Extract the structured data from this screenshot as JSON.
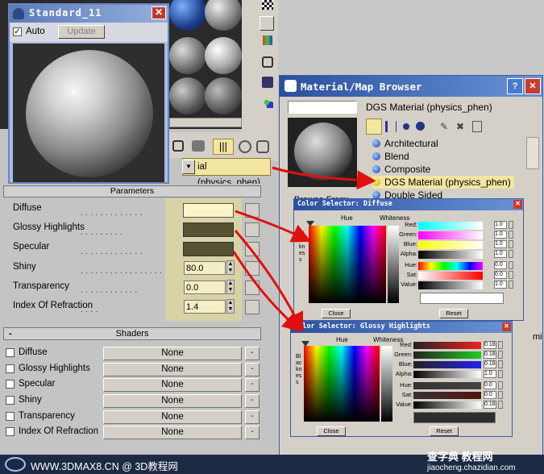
{
  "viewport": {
    "width": 675,
    "height": 588
  },
  "material_preview": {
    "title": "Standard_11",
    "auto_label": "Auto",
    "auto_checked": true,
    "update_label": "Update"
  },
  "editor": {
    "material_name_field": "ial (physics_phen)",
    "rollout_title": "Parameters",
    "params": [
      {
        "label": "Diffuse",
        "type": "color",
        "color": "#fbf4c8"
      },
      {
        "label": "Glossy Highlights",
        "type": "color",
        "color": "#575234"
      },
      {
        "label": "Specular",
        "type": "color",
        "color": "#575234"
      },
      {
        "label": "Shiny",
        "type": "number",
        "value": "80.0"
      },
      {
        "label": "Transparency",
        "type": "number",
        "value": "0.0"
      },
      {
        "label": "Index Of Refraction",
        "type": "number",
        "value": "1.4"
      }
    ],
    "shaders_title": "Shaders",
    "shaders": [
      {
        "label": "Diffuse",
        "value": "None"
      },
      {
        "label": "Glossy Highlights",
        "value": "None"
      },
      {
        "label": "Specular",
        "value": "None"
      },
      {
        "label": "Shiny",
        "value": "None"
      },
      {
        "label": "Transparency",
        "value": "None"
      },
      {
        "label": "Index Of Refraction",
        "value": "None"
      }
    ],
    "rollout_minus": "-",
    "shader_button_label": "-"
  },
  "browser": {
    "title": "Material/Map Browser",
    "name_field": "DGS Material (physics_phen)",
    "browse_from": "Browse From:",
    "items": [
      {
        "label": "Architectural",
        "selected": false
      },
      {
        "label": "Blend",
        "selected": false
      },
      {
        "label": "Composite",
        "selected": false
      },
      {
        "label": "DGS Material (physics_phen)",
        "selected": true
      },
      {
        "label": "Double Sided",
        "selected": false
      }
    ],
    "clip_text": "mi"
  },
  "color_selector_diffuse": {
    "title": "Color Selector: Diffuse",
    "hue": "Hue",
    "whiteness": "Whiteness",
    "blackness": "Blackness",
    "channels": [
      {
        "label": "Red:",
        "value": "1.0"
      },
      {
        "label": "Green:",
        "value": "1.0"
      },
      {
        "label": "Blue:",
        "value": "1.0"
      },
      {
        "label": "Alpha:",
        "value": "1.0"
      },
      {
        "label": "Hue:",
        "value": "0.0"
      },
      {
        "label": "Sat:",
        "value": "0.0"
      },
      {
        "label": "Value:",
        "value": "1.0"
      }
    ],
    "close": "Close",
    "reset": "Reset"
  },
  "color_selector_glossy": {
    "title": "Color Selector: Glossy Highlights",
    "hue": "Hue",
    "whiteness": "Whiteness",
    "blackness": "Blackness",
    "channels": [
      {
        "label": "Red:",
        "value": "0.18"
      },
      {
        "label": "Green:",
        "value": "0.18"
      },
      {
        "label": "Blue:",
        "value": "0.18"
      },
      {
        "label": "Alpha:",
        "value": "1.0"
      },
      {
        "label": "Hue:",
        "value": "0.0"
      },
      {
        "label": "Sat:",
        "value": "0.0"
      },
      {
        "label": "Value:",
        "value": "0.18"
      }
    ],
    "close": "Close",
    "reset": "Reset"
  },
  "footer": {
    "left": "WWW.3DMAX8.CN @ 3D教程网",
    "right_top": "查字典 教程网",
    "right_bottom": "jiaocheng.chazidian.com"
  }
}
